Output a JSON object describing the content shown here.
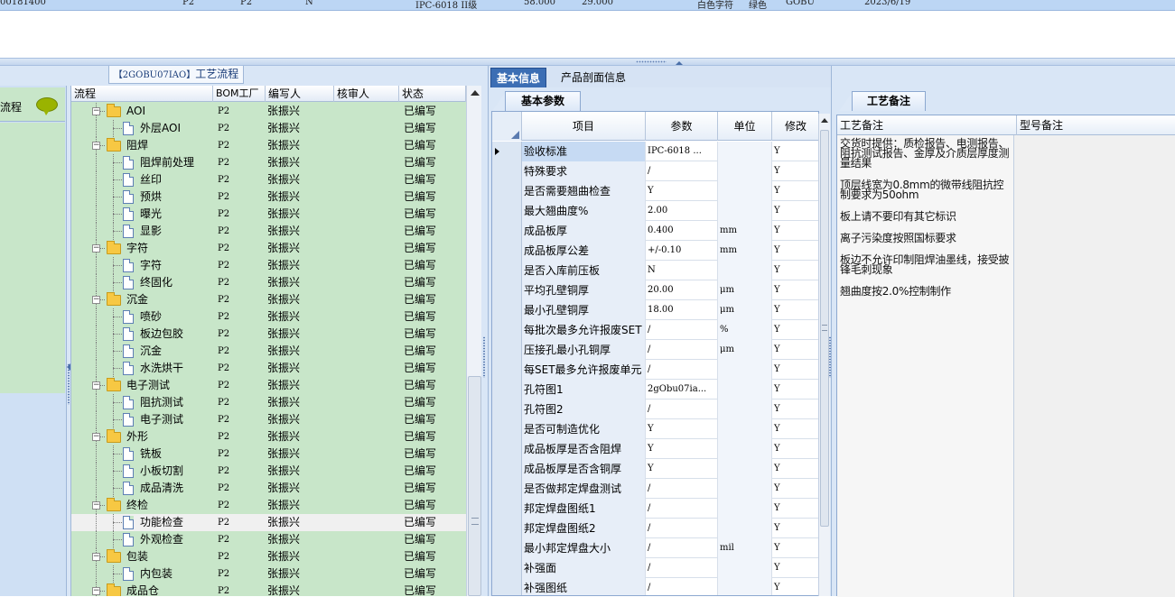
{
  "top_row": [
    "00181400",
    "P2",
    "P2",
    "N",
    "IPC-6018 II级",
    "58.000",
    "29.000",
    "白色字符",
    "绿色",
    "GOBU",
    "2023/6/19"
  ],
  "left": {
    "header": {
      "code": "【2GOBU07IAO】",
      "title": "工艺流程"
    },
    "strip_label": "流程",
    "columns": {
      "flow": "流程",
      "bom": "BOM工厂",
      "writer": "编写人",
      "reviewer": "核审人",
      "status": "状态"
    },
    "rows": [
      {
        "name": "AOI",
        "level": 0,
        "bom": "P2",
        "writer": "张振兴",
        "status": "已编写"
      },
      {
        "name": "外层AOI",
        "level": 1,
        "bom": "P2",
        "writer": "张振兴",
        "status": "已编写"
      },
      {
        "name": "阻焊",
        "level": 0,
        "bom": "P2",
        "writer": "张振兴",
        "status": "已编写"
      },
      {
        "name": "阻焊前处理",
        "level": 1,
        "bom": "P2",
        "writer": "张振兴",
        "status": "已编写"
      },
      {
        "name": "丝印",
        "level": 1,
        "bom": "P2",
        "writer": "张振兴",
        "status": "已编写"
      },
      {
        "name": "预烘",
        "level": 1,
        "bom": "P2",
        "writer": "张振兴",
        "status": "已编写"
      },
      {
        "name": "曝光",
        "level": 1,
        "bom": "P2",
        "writer": "张振兴",
        "status": "已编写"
      },
      {
        "name": "显影",
        "level": 1,
        "bom": "P2",
        "writer": "张振兴",
        "status": "已编写"
      },
      {
        "name": "字符",
        "level": 0,
        "bom": "P2",
        "writer": "张振兴",
        "status": "已编写"
      },
      {
        "name": "字符",
        "level": 1,
        "bom": "P2",
        "writer": "张振兴",
        "status": "已编写"
      },
      {
        "name": "终固化",
        "level": 1,
        "bom": "P2",
        "writer": "张振兴",
        "status": "已编写"
      },
      {
        "name": "沉金",
        "level": 0,
        "bom": "P2",
        "writer": "张振兴",
        "status": "已编写"
      },
      {
        "name": "喷砂",
        "level": 1,
        "bom": "P2",
        "writer": "张振兴",
        "status": "已编写"
      },
      {
        "name": "板边包胶",
        "level": 1,
        "bom": "P2",
        "writer": "张振兴",
        "status": "已编写"
      },
      {
        "name": "沉金",
        "level": 1,
        "bom": "P2",
        "writer": "张振兴",
        "status": "已编写"
      },
      {
        "name": "水洗烘干",
        "level": 1,
        "bom": "P2",
        "writer": "张振兴",
        "status": "已编写"
      },
      {
        "name": "电子测试",
        "level": 0,
        "bom": "P2",
        "writer": "张振兴",
        "status": "已编写"
      },
      {
        "name": "阻抗测试",
        "level": 1,
        "bom": "P2",
        "writer": "张振兴",
        "status": "已编写"
      },
      {
        "name": "电子测试",
        "level": 1,
        "bom": "P2",
        "writer": "张振兴",
        "status": "已编写"
      },
      {
        "name": "外形",
        "level": 0,
        "bom": "P2",
        "writer": "张振兴",
        "status": "已编写"
      },
      {
        "name": "铣板",
        "level": 1,
        "bom": "P2",
        "writer": "张振兴",
        "status": "已编写"
      },
      {
        "name": "小板切割",
        "level": 1,
        "bom": "P2",
        "writer": "张振兴",
        "status": "已编写"
      },
      {
        "name": "成品清洗",
        "level": 1,
        "bom": "P2",
        "writer": "张振兴",
        "status": "已编写"
      },
      {
        "name": "终检",
        "level": 0,
        "bom": "P2",
        "writer": "张振兴",
        "status": "已编写"
      },
      {
        "name": "功能检查",
        "level": 1,
        "bom": "P2",
        "writer": "张振兴",
        "status": "已编写",
        "selected": true
      },
      {
        "name": "外观检查",
        "level": 1,
        "bom": "P2",
        "writer": "张振兴",
        "status": "已编写"
      },
      {
        "name": "包装",
        "level": 0,
        "bom": "P2",
        "writer": "张振兴",
        "status": "已编写"
      },
      {
        "name": "内包装",
        "level": 1,
        "bom": "P2",
        "writer": "张振兴",
        "status": "已编写"
      },
      {
        "name": "成品仓",
        "level": 0,
        "bom": "P2",
        "writer": "张振兴",
        "status": "已编写"
      }
    ]
  },
  "middle": {
    "tabs": [
      "基本信息",
      "产品剖面信息"
    ],
    "subtab": "基本参数",
    "columns": {
      "item": "项目",
      "param": "参数",
      "unit": "单位",
      "edit": "修改"
    },
    "rows": [
      {
        "item": "验收标准",
        "param": "IPC-6018 ...",
        "unit": "",
        "edit": "Y",
        "current": true
      },
      {
        "item": "特殊要求",
        "param": "/",
        "unit": "",
        "edit": "Y"
      },
      {
        "item": "是否需要翘曲检查",
        "param": "Y",
        "unit": "",
        "edit": "Y"
      },
      {
        "item": "最大翘曲度%",
        "param": "2.00",
        "unit": "",
        "edit": "Y"
      },
      {
        "item": "成品板厚",
        "param": "0.400",
        "unit": "mm",
        "edit": "Y"
      },
      {
        "item": "成品板厚公差",
        "param": "+/-0.10",
        "unit": "mm",
        "edit": "Y"
      },
      {
        "item": "是否入库前压板",
        "param": "N",
        "unit": "",
        "edit": "Y"
      },
      {
        "item": "平均孔壁铜厚",
        "param": "20.00",
        "unit": "μm",
        "edit": "Y"
      },
      {
        "item": "最小孔壁铜厚",
        "param": "18.00",
        "unit": "μm",
        "edit": "Y"
      },
      {
        "item": "每批次最多允许报废SET",
        "param": "/",
        "unit": "%",
        "edit": "Y"
      },
      {
        "item": "压接孔最小孔铜厚",
        "param": "/",
        "unit": "μm",
        "edit": "Y"
      },
      {
        "item": "每SET最多允许报废单元",
        "param": "/",
        "unit": "",
        "edit": "Y"
      },
      {
        "item": "孔符图1",
        "param": "2gObu07ia...",
        "unit": "",
        "edit": "Y"
      },
      {
        "item": "孔符图2",
        "param": "/",
        "unit": "",
        "edit": "Y"
      },
      {
        "item": "是否可制造优化",
        "param": "Y",
        "unit": "",
        "edit": "Y"
      },
      {
        "item": "成品板厚是否含阻焊",
        "param": "Y",
        "unit": "",
        "edit": "Y"
      },
      {
        "item": "成品板厚是否含铜厚",
        "param": "Y",
        "unit": "",
        "edit": "Y"
      },
      {
        "item": "是否做邦定焊盘测试",
        "param": "/",
        "unit": "",
        "edit": "Y"
      },
      {
        "item": "邦定焊盘图纸1",
        "param": "/",
        "unit": "",
        "edit": "Y"
      },
      {
        "item": "邦定焊盘图纸2",
        "param": "/",
        "unit": "",
        "edit": "Y"
      },
      {
        "item": "最小邦定焊盘大小",
        "param": "/",
        "unit": "mil",
        "edit": "Y"
      },
      {
        "item": "补强面",
        "param": "/",
        "unit": "",
        "edit": "Y"
      },
      {
        "item": "补强图纸",
        "param": "/",
        "unit": "",
        "edit": "Y"
      }
    ]
  },
  "right": {
    "tab": "工艺备注",
    "columns": {
      "process_note": "工艺备注",
      "model_note": "型号备注"
    },
    "notes": [
      "交货时提供：质检报告、电测报告、阻抗测试报告、金厚及介质层厚度测量结果",
      "顶层线宽为0.8mm的微带线阻抗控制要求为50ohm",
      "板上请不要印有其它标识",
      "离子污染度按照国标要求",
      "板边不允许印制阻焊油墨线，接受披锋毛刺现象",
      "翘曲度按2.0%控制制作"
    ]
  }
}
